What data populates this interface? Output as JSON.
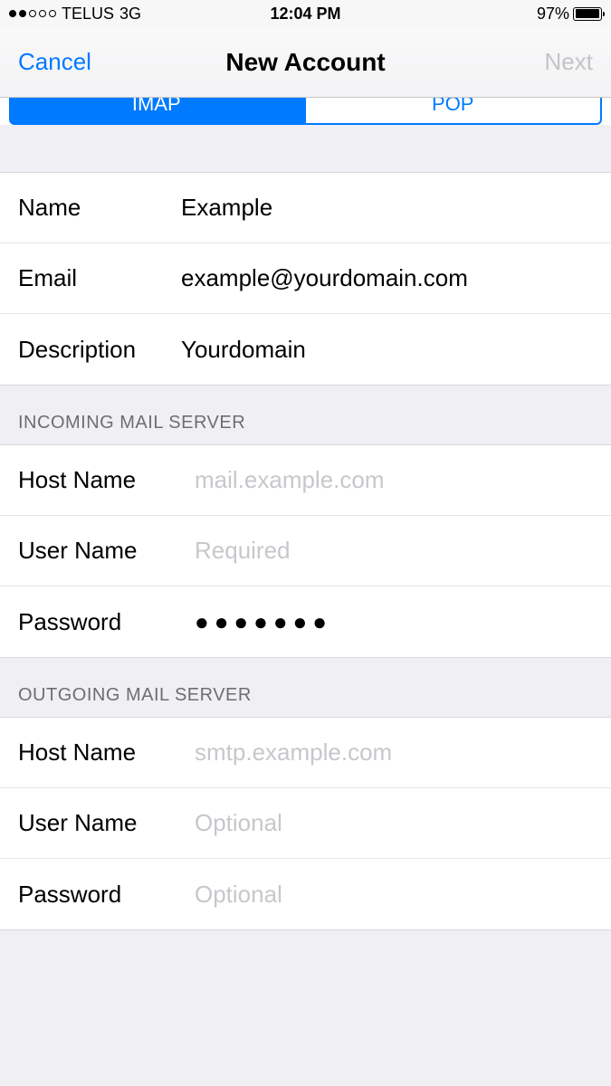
{
  "statusBar": {
    "carrier": "TELUS",
    "network": "3G",
    "time": "12:04 PM",
    "batteryPercent": "97%"
  },
  "navBar": {
    "cancel": "Cancel",
    "title": "New Account",
    "next": "Next"
  },
  "segments": {
    "imap": "IMAP",
    "pop": "POP"
  },
  "accountInfo": {
    "nameLabel": "Name",
    "nameValue": "Example",
    "emailLabel": "Email",
    "emailValue": "example@yourdomain.com",
    "descriptionLabel": "Description",
    "descriptionValue": "Yourdomain"
  },
  "incoming": {
    "header": "INCOMING MAIL SERVER",
    "hostLabel": "Host Name",
    "hostPlaceholder": "mail.example.com",
    "userLabel": "User Name",
    "userPlaceholder": "Required",
    "passwordLabel": "Password",
    "passwordValue": "●●●●●●●"
  },
  "outgoing": {
    "header": "OUTGOING MAIL SERVER",
    "hostLabel": "Host Name",
    "hostPlaceholder": "smtp.example.com",
    "userLabel": "User Name",
    "userPlaceholder": "Optional",
    "passwordLabel": "Password",
    "passwordPlaceholder": "Optional"
  }
}
